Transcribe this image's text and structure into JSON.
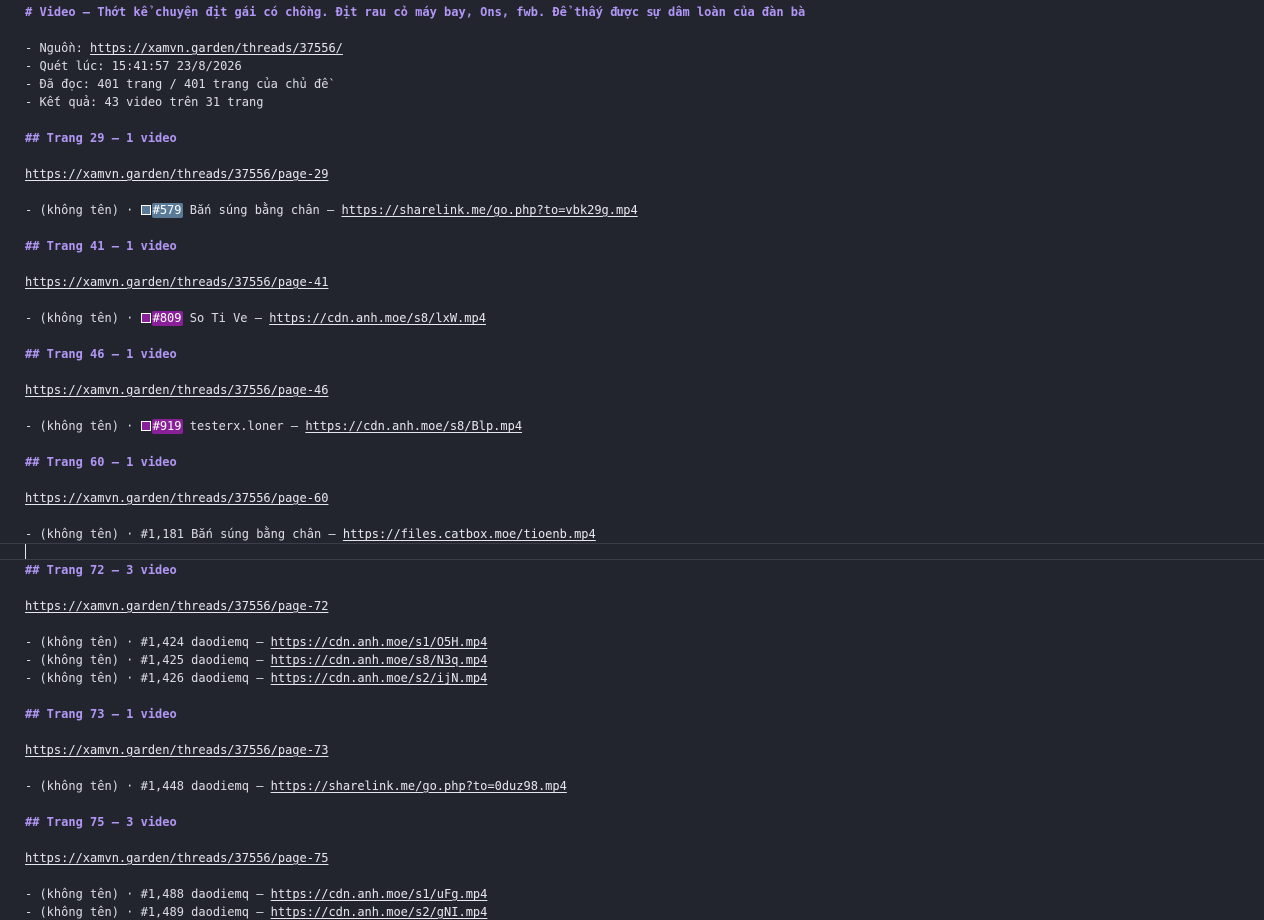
{
  "colors": {
    "background": "#23252e",
    "heading": "#b196f5",
    "tag_579": "#5a7a9a",
    "tag_809": "#8a1f9a",
    "tag_919": "#8a1f9a"
  },
  "doc": {
    "title": "# Video — Thớt kể chuyện địt gái có chồng. Địt rau cỏ máy bay, Ons, fwb. Để thấy được sự dâm loàn của đàn bà",
    "meta": {
      "source_label": "- Nguồn: ",
      "source_url": "https://xamvn.garden/threads/37556/",
      "scanned": "- Quét lúc: 15:41:57 23/8/2026",
      "read": "- Đã đọc: 401 trang / 401 trang của chủ đề",
      "result": "- Kết quả: 43 video trên 31 trang"
    },
    "sections": [
      {
        "heading": "## Trang 29 — 1 video",
        "page_url": "https://xamvn.garden/threads/37556/page-29",
        "items": [
          {
            "prefix": "- (không tên) · ",
            "tag": "#579",
            "text": " Bắn súng bằng chân — ",
            "url": "https://sharelink.me/go.php?to=vbk29g.mp4"
          }
        ]
      },
      {
        "heading": "## Trang 41 — 1 video",
        "page_url": "https://xamvn.garden/threads/37556/page-41",
        "items": [
          {
            "prefix": "- (không tên) · ",
            "tag": "#809",
            "text": " So Ti Ve — ",
            "url": "https://cdn.anh.moe/s8/lxW.mp4"
          }
        ]
      },
      {
        "heading": "## Trang 46 — 1 video",
        "page_url": "https://xamvn.garden/threads/37556/page-46",
        "items": [
          {
            "prefix": "- (không tên) · ",
            "tag": "#919",
            "text": " testerx.loner — ",
            "url": "https://cdn.anh.moe/s8/Blp.mp4"
          }
        ]
      },
      {
        "heading": "## Trang 60 — 1 video",
        "page_url": "https://xamvn.garden/threads/37556/page-60",
        "items": [
          {
            "text": "- (không tên) · #1,181 Bắn súng bằng chân — ",
            "url": "https://files.catbox.moe/tioenb.mp4"
          }
        ]
      },
      {
        "heading": "## Trang 72 — 3 video",
        "page_url": "https://xamvn.garden/threads/37556/page-72",
        "items": [
          {
            "text": "- (không tên) · #1,424 daodiemq — ",
            "url": "https://cdn.anh.moe/s1/O5H.mp4"
          },
          {
            "text": "- (không tên) · #1,425 daodiemq — ",
            "url": "https://cdn.anh.moe/s8/N3q.mp4"
          },
          {
            "text": "- (không tên) · #1,426 daodiemq — ",
            "url": "https://cdn.anh.moe/s2/ijN.mp4"
          }
        ]
      },
      {
        "heading": "## Trang 73 — 1 video",
        "page_url": "https://xamvn.garden/threads/37556/page-73",
        "items": [
          {
            "text": "- (không tên) · #1,448 daodiemq — ",
            "url": "https://sharelink.me/go.php?to=0duz98.mp4"
          }
        ]
      },
      {
        "heading": "## Trang 75 — 3 video",
        "page_url": "https://xamvn.garden/threads/37556/page-75",
        "items": [
          {
            "text": "- (không tên) · #1,488 daodiemq — ",
            "url": "https://cdn.anh.moe/s1/uFg.mp4"
          },
          {
            "text": "- (không tên) · #1,489 daodiemq — ",
            "url": "https://cdn.anh.moe/s2/gNI.mp4"
          }
        ]
      }
    ]
  }
}
